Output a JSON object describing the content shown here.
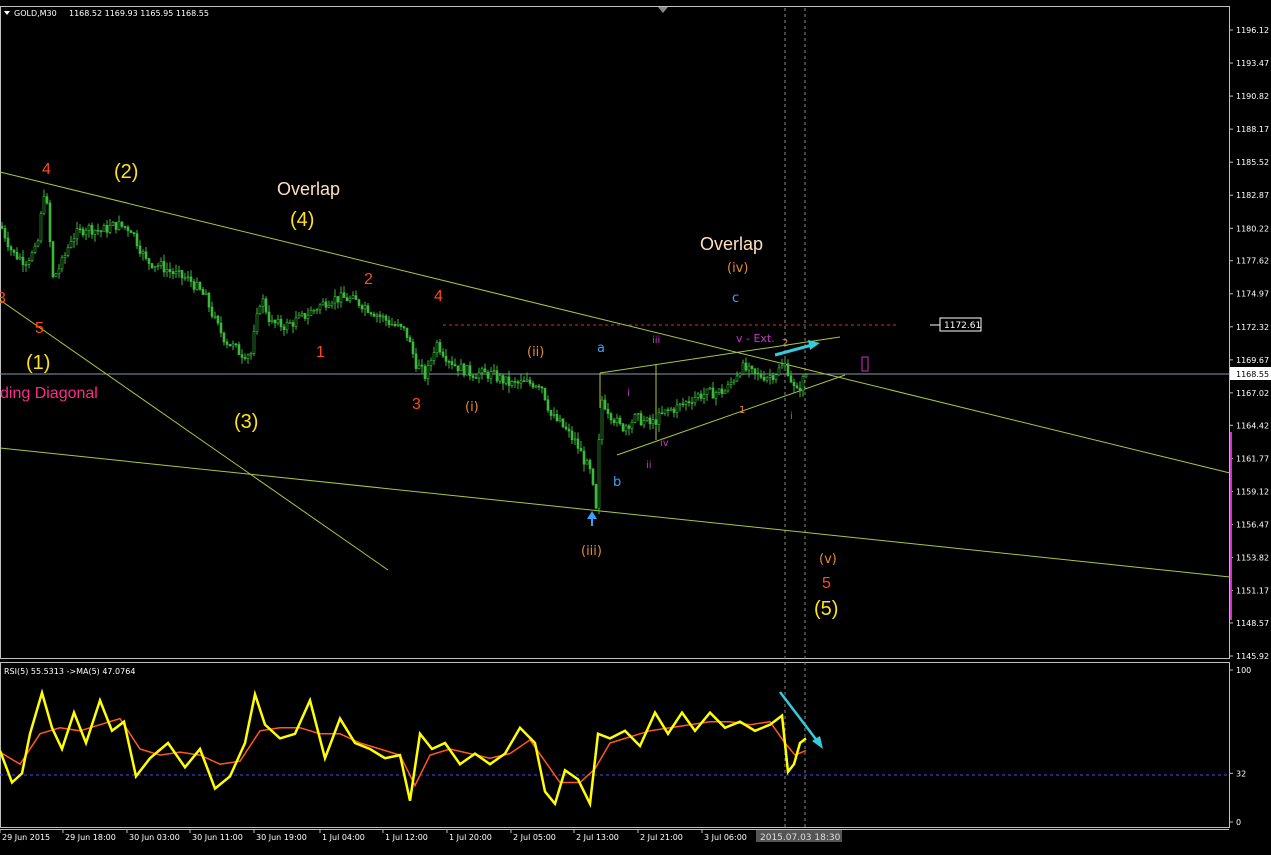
{
  "header": {
    "symbol": "GOLD,M30",
    "ohlc": "1168.52 1169.93 1165.95 1168.55"
  },
  "price_axis": {
    "ticks": [
      "1196.12",
      "1193.47",
      "1190.82",
      "1188.17",
      "1185.52",
      "1182.87",
      "1180.22",
      "1177.62",
      "1174.97",
      "1172.32",
      "1169.67",
      "1167.02",
      "1164.42",
      "1161.77",
      "1159.12",
      "1156.47",
      "1153.82",
      "1151.17",
      "1148.57",
      "1145.92"
    ],
    "current_price": "1168.55",
    "level_box": "1172.61"
  },
  "rsi": {
    "header": "RSI(5) 55.5313 ->MA(5) 47.0764",
    "ticks": [
      "100",
      "32",
      "0"
    ],
    "level": 32
  },
  "time_axis": {
    "labels": [
      "29 Jun 2015",
      "29 Jun 18:00",
      "30 Jun 03:00",
      "30 Jun 11:00",
      "30 Jun 19:00",
      "1 Jul 04:00",
      "1 Jul 12:00",
      "1 Jul 20:00",
      "2 Jul 05:00",
      "2 Jul 13:00",
      "2 Jul 21:00",
      "3 Jul 06:00"
    ],
    "cursor_label": "2015.07.03 18:30"
  },
  "labels": {
    "l_4a": "4",
    "l_5a": "5",
    "l_3cut": "3",
    "l_1p": "(1)",
    "l_diag": "ding Diagonal",
    "l_2p": "(2)",
    "l_overlap1": "Overlap",
    "l_4p": "(4)",
    "l_3p": "(3)",
    "l_2": "2",
    "l_1": "1",
    "l_4b": "4",
    "l_3": "3",
    "l_ii": "(ii)",
    "l_i": "(i)",
    "l_iii": "(iii)",
    "l_a": "a",
    "l_b": "b",
    "l_c": "c",
    "l_overlap2": "Overlap",
    "l_iv": "(iv)",
    "l_m_iii": "iii",
    "l_m_i": "i",
    "l_m_ii": "ii",
    "l_m_iv": "iv",
    "l_vext": "v - Ext.",
    "l_1s": "1",
    "l_i2": "i",
    "l_2s": "2",
    "l_v": "(v)",
    "l_5": "5",
    "l_5p": "(5)"
  },
  "colors": {
    "bg": "#000000",
    "candle": "#3cb93c",
    "trendline": "#a8c840",
    "red_label": "#ff4a1a",
    "yellow_label": "#ffe21a",
    "orange_label": "#e68a2e",
    "cream_label": "#ffe0c0",
    "blue_label": "#3aa0ff",
    "magenta_label": "#cc33cc",
    "pink": "#ff2a8c",
    "cyan_arrow": "#33ccdd",
    "rsi_line": "#ffff00",
    "rsi_ma": "#ff5a1a",
    "grid": "#c0c0c0"
  },
  "chart_data": {
    "type": "candlestick",
    "symbol": "GOLD",
    "timeframe": "M30",
    "ylim": [
      1145.92,
      1196.12
    ],
    "close_path": [
      [
        0,
        1180.4
      ],
      [
        12,
        1178.2
      ],
      [
        24,
        1177.6
      ],
      [
        36,
        1178.5
      ],
      [
        44,
        1183.8
      ],
      [
        52,
        1176.2
      ],
      [
        62,
        1177.6
      ],
      [
        70,
        1179.4
      ],
      [
        85,
        1180.3
      ],
      [
        100,
        1180.0
      ],
      [
        115,
        1180.5
      ],
      [
        130,
        1180.2
      ],
      [
        145,
        1177.6
      ],
      [
        160,
        1177.2
      ],
      [
        175,
        1176.5
      ],
      [
        190,
        1176.0
      ],
      [
        205,
        1174.6
      ],
      [
        215,
        1172.6
      ],
      [
        225,
        1171.2
      ],
      [
        240,
        1170.2
      ],
      [
        250,
        1170.2
      ],
      [
        260,
        1174.8
      ],
      [
        270,
        1172.6
      ],
      [
        285,
        1172.4
      ],
      [
        300,
        1173.0
      ],
      [
        315,
        1173.8
      ],
      [
        330,
        1174.6
      ],
      [
        345,
        1174.6
      ],
      [
        360,
        1174.2
      ],
      [
        375,
        1173.4
      ],
      [
        390,
        1172.6
      ],
      [
        405,
        1171.9
      ],
      [
        415,
        1169.4
      ],
      [
        425,
        1168.3
      ],
      [
        435,
        1171.1
      ],
      [
        445,
        1170.0
      ],
      [
        455,
        1169.2
      ],
      [
        470,
        1168.6
      ],
      [
        490,
        1168.5
      ],
      [
        510,
        1167.7
      ],
      [
        525,
        1167.8
      ],
      [
        540,
        1167.8
      ],
      [
        550,
        1165.2
      ],
      [
        560,
        1164.5
      ],
      [
        575,
        1163.0
      ],
      [
        590,
        1160.5
      ],
      [
        595,
        1157.5
      ],
      [
        600,
        1166.6
      ],
      [
        610,
        1165.3
      ],
      [
        620,
        1164.2
      ],
      [
        635,
        1165.0
      ],
      [
        650,
        1164.5
      ],
      [
        665,
        1165.5
      ],
      [
        680,
        1166.0
      ],
      [
        695,
        1166.8
      ],
      [
        710,
        1167.0
      ],
      [
        725,
        1167.2
      ],
      [
        740,
        1169.1
      ],
      [
        755,
        1168.4
      ],
      [
        770,
        1168.4
      ],
      [
        785,
        1169.3
      ],
      [
        795,
        1166.9
      ],
      [
        805,
        1168.5
      ]
    ],
    "rsi": {
      "period": 5,
      "ma_period": 5,
      "value": 55.5313,
      "ma_value": 47.0764,
      "level": 32,
      "ylim": [
        0,
        100
      ],
      "values": [
        [
          0,
          47
        ],
        [
          12,
          26
        ],
        [
          22,
          32
        ],
        [
          30,
          58
        ],
        [
          42,
          85
        ],
        [
          52,
          62
        ],
        [
          62,
          48
        ],
        [
          74,
          72
        ],
        [
          86,
          52
        ],
        [
          100,
          80
        ],
        [
          112,
          60
        ],
        [
          124,
          66
        ],
        [
          136,
          30
        ],
        [
          150,
          42
        ],
        [
          168,
          52
        ],
        [
          185,
          36
        ],
        [
          200,
          48
        ],
        [
          215,
          22
        ],
        [
          230,
          30
        ],
        [
          245,
          52
        ],
        [
          255,
          84
        ],
        [
          265,
          64
        ],
        [
          280,
          55
        ],
        [
          295,
          58
        ],
        [
          310,
          80
        ],
        [
          325,
          42
        ],
        [
          340,
          68
        ],
        [
          355,
          52
        ],
        [
          370,
          48
        ],
        [
          385,
          42
        ],
        [
          400,
          44
        ],
        [
          410,
          14
        ],
        [
          420,
          58
        ],
        [
          432,
          48
        ],
        [
          445,
          52
        ],
        [
          460,
          38
        ],
        [
          475,
          45
        ],
        [
          490,
          38
        ],
        [
          505,
          45
        ],
        [
          520,
          62
        ],
        [
          535,
          52
        ],
        [
          545,
          20
        ],
        [
          555,
          12
        ],
        [
          565,
          34
        ],
        [
          578,
          28
        ],
        [
          590,
          12
        ],
        [
          598,
          58
        ],
        [
          610,
          55
        ],
        [
          625,
          60
        ],
        [
          640,
          50
        ],
        [
          655,
          72
        ],
        [
          668,
          58
        ],
        [
          682,
          72
        ],
        [
          695,
          60
        ],
        [
          710,
          72
        ],
        [
          725,
          62
        ],
        [
          740,
          66
        ],
        [
          755,
          60
        ],
        [
          770,
          64
        ],
        [
          782,
          70
        ],
        [
          788,
          33
        ],
        [
          794,
          38
        ],
        [
          800,
          52
        ],
        [
          806,
          55
        ]
      ],
      "ma": [
        [
          0,
          46
        ],
        [
          20,
          38
        ],
        [
          40,
          58
        ],
        [
          60,
          62
        ],
        [
          80,
          60
        ],
        [
          100,
          64
        ],
        [
          120,
          68
        ],
        [
          140,
          48
        ],
        [
          160,
          44
        ],
        [
          180,
          46
        ],
        [
          200,
          44
        ],
        [
          220,
          38
        ],
        [
          240,
          40
        ],
        [
          260,
          60
        ],
        [
          280,
          62
        ],
        [
          300,
          62
        ],
        [
          320,
          58
        ],
        [
          340,
          58
        ],
        [
          360,
          52
        ],
        [
          380,
          48
        ],
        [
          400,
          44
        ],
        [
          415,
          24
        ],
        [
          430,
          44
        ],
        [
          450,
          48
        ],
        [
          470,
          45
        ],
        [
          490,
          42
        ],
        [
          510,
          45
        ],
        [
          530,
          54
        ],
        [
          545,
          40
        ],
        [
          560,
          26
        ],
        [
          580,
          26
        ],
        [
          595,
          35
        ],
        [
          610,
          52
        ],
        [
          630,
          56
        ],
        [
          650,
          60
        ],
        [
          670,
          62
        ],
        [
          690,
          64
        ],
        [
          710,
          66
        ],
        [
          730,
          66
        ],
        [
          750,
          64
        ],
        [
          770,
          66
        ],
        [
          785,
          52
        ],
        [
          795,
          44
        ],
        [
          806,
          47
        ]
      ]
    }
  }
}
